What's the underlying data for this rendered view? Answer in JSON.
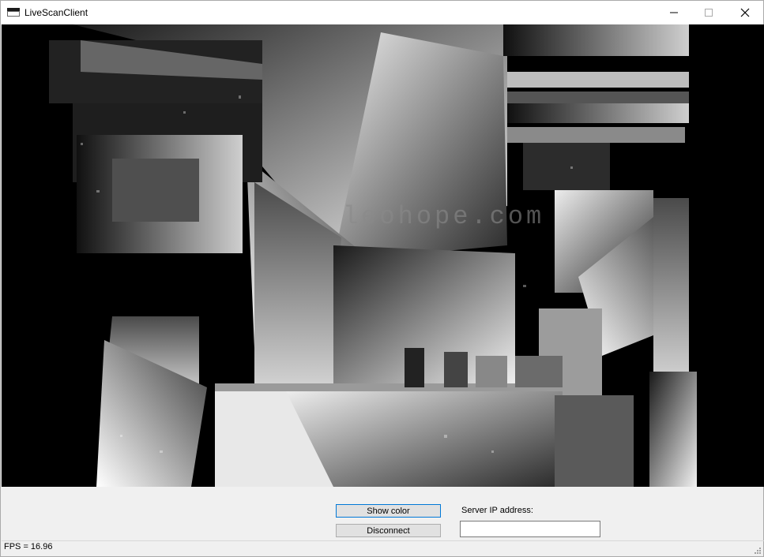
{
  "window": {
    "title": "LiveScanClient"
  },
  "title_controls": {
    "minimize": "minimize-icon",
    "maximize": "maximize-icon",
    "close": "close-icon"
  },
  "viewport": {
    "type": "depth-image",
    "watermark": "leohope.com"
  },
  "controls": {
    "show_color_label": "Show color",
    "disconnect_label": "Disconnect",
    "server_ip_label": "Server IP address:",
    "server_ip_value": ""
  },
  "status": {
    "fps_text": "FPS = 16.96"
  }
}
